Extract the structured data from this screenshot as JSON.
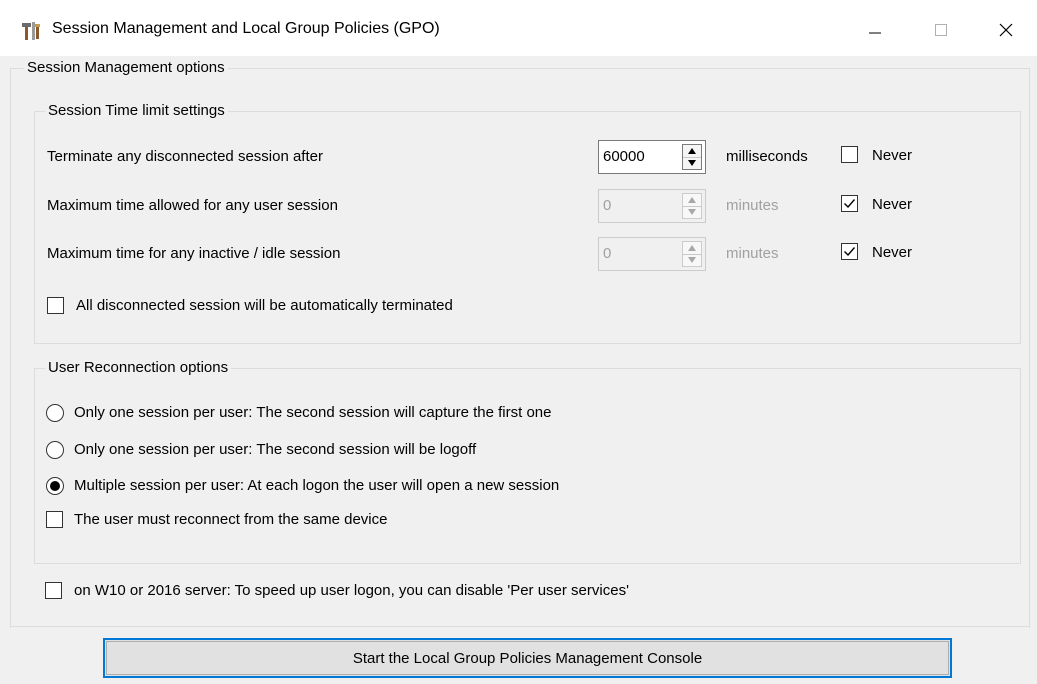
{
  "window": {
    "title": "Session Management and Local Group Policies (GPO)",
    "icon": "tools-icon"
  },
  "session_management": {
    "legend": "Session Management options",
    "time_limits": {
      "legend": "Session Time limit settings",
      "rows": [
        {
          "label": "Terminate any disconnected session after",
          "value": "60000",
          "unit": "milliseconds",
          "never_label": "Never",
          "never_checked": false,
          "enabled": true
        },
        {
          "label": "Maximum time allowed for any user session",
          "value": "0",
          "unit": "minutes",
          "never_label": "Never",
          "never_checked": true,
          "enabled": false
        },
        {
          "label": "Maximum time for any inactive / idle session",
          "value": "0",
          "unit": "minutes",
          "never_label": "Never",
          "never_checked": true,
          "enabled": false
        }
      ],
      "auto_terminate": {
        "label": "All disconnected session will be automatically terminated",
        "checked": false
      }
    },
    "reconnection": {
      "legend": "User Reconnection options",
      "options": [
        {
          "label": "Only one session per user: The second session will capture the first one",
          "selected": false
        },
        {
          "label": "Only one session per user: The second session will be logoff",
          "selected": false
        },
        {
          "label": "Multiple session per user: At each logon the user will open a new session",
          "selected": true
        }
      ],
      "same_device": {
        "label": "The user must reconnect from the same device",
        "checked": false
      }
    },
    "per_user_services": {
      "label": "on W10 or 2016 server: To speed up user logon, you can disable 'Per user services'",
      "checked": false
    }
  },
  "actions": {
    "start_console_label": "Start the Local Group Policies Management Console"
  }
}
